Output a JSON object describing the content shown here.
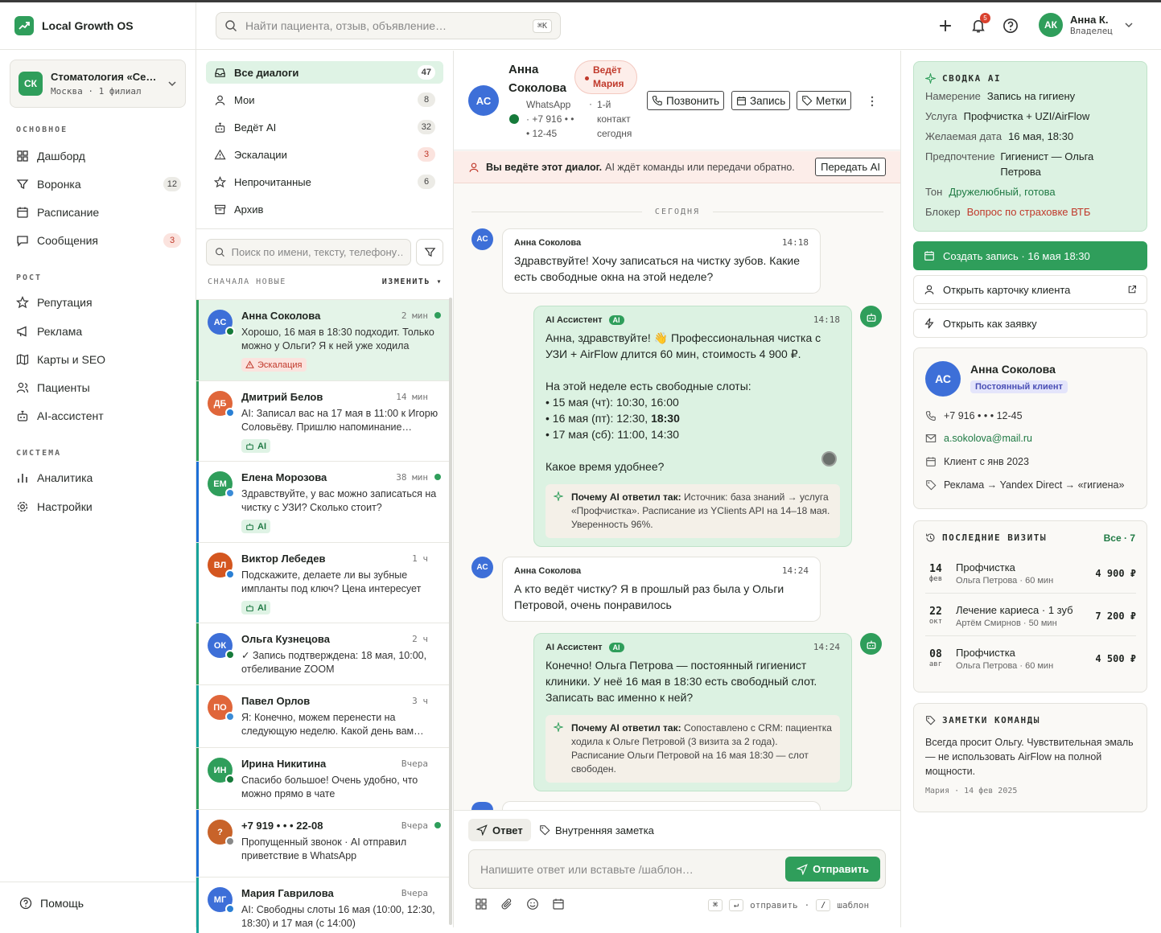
{
  "app": {
    "title": "Local Growth OS"
  },
  "org": {
    "initials": "СК",
    "name": "Стоматология «Се…",
    "sub": "Москва · 1 филиал"
  },
  "nav": {
    "sections": [
      {
        "title": "ОСНОВНОЕ",
        "items": [
          {
            "label": "Дашборд",
            "icon": "dashboard-icon"
          },
          {
            "label": "Воронка",
            "icon": "filter-icon",
            "badge": "12"
          },
          {
            "label": "Расписание",
            "icon": "calendar-icon"
          },
          {
            "label": "Сообщения",
            "icon": "message-icon",
            "badge": "3"
          }
        ]
      },
      {
        "title": "РОСТ",
        "items": [
          {
            "label": "Репутация",
            "icon": "star-icon"
          },
          {
            "label": "Реклама",
            "icon": "megaphone-icon"
          },
          {
            "label": "Карты и SEO",
            "icon": "map-icon"
          },
          {
            "label": "Пациенты",
            "icon": "users-icon"
          },
          {
            "label": "AI-ассистент",
            "icon": "bot-icon"
          }
        ]
      },
      {
        "title": "СИСТЕМА",
        "items": [
          {
            "label": "Аналитика",
            "icon": "chart-icon"
          },
          {
            "label": "Настройки",
            "icon": "gear-icon"
          }
        ]
      }
    ],
    "help": "Помощь"
  },
  "header": {
    "search_placeholder": "Найти пациента, отзыв, объявление…",
    "search_kbd": "⌘K",
    "notifications": "5",
    "user": {
      "initials": "АК",
      "name": "Анна К.",
      "role": "Владелец"
    }
  },
  "filters": [
    {
      "label": "Все диалоги",
      "count": "47",
      "icon": "inbox-icon"
    },
    {
      "label": "Мои",
      "count": "8",
      "icon": "user-icon"
    },
    {
      "label": "Ведёт AI",
      "count": "32",
      "icon": "bot-icon"
    },
    {
      "label": "Эскалации",
      "count": "3",
      "icon": "warning-icon"
    },
    {
      "label": "Непрочитанные",
      "count": "6",
      "icon": "star-icon"
    },
    {
      "label": "Архив",
      "count": "",
      "icon": "archive-icon"
    }
  ],
  "list": {
    "search_placeholder": "Поиск по имени, тексту, телефону…",
    "sort_label": "СНАЧАЛА НОВЫЕ",
    "sort_change": "ИЗМЕНИТЬ ▾",
    "conversations": [
      {
        "initials": "АС",
        "name": "Анна Соколова",
        "time": "2 мин",
        "preview": "Хорошо, 16 мая в 18:30 подходит. Только можно у Ольги? Я к ней уже ходила",
        "tag": "Эскалация",
        "tag_type": "esc",
        "unread": true,
        "avatar_color": "#3d6fd8",
        "channel": "whatsapp",
        "bar_color": "#2f9e5b"
      },
      {
        "initials": "ДБ",
        "name": "Дмитрий Белов",
        "time": "14 мин",
        "preview": "AI: Записал вас на 17 мая в 11:00 к Игорю Соловьёву. Пришлю напоминание накануне",
        "tag": "AI",
        "tag_type": "ai",
        "unread": false,
        "avatar_color": "#e0663a",
        "channel": "telegram",
        "bar_color": "#2f9e5b"
      },
      {
        "initials": "ЕМ",
        "name": "Елена Морозова",
        "time": "38 мин",
        "preview": "Здравствуйте, у вас можно записаться на чистку с УЗИ? Сколько стоит?",
        "tag": "AI",
        "tag_type": "ai",
        "unread": true,
        "avatar_color": "#2f9e5b",
        "channel": "web",
        "bar_color": "#1d6fd6"
      },
      {
        "initials": "ВЛ",
        "name": "Виктор Лебедев",
        "time": "1 ч",
        "preview": "Подскажите, делаете ли вы зубные импланты под ключ? Цена интересует",
        "tag": "AI",
        "tag_type": "ai",
        "unread": false,
        "avatar_color": "#d4561f",
        "channel": "telegram",
        "bar_color": "#17a39a"
      },
      {
        "initials": "ОК",
        "name": "Ольга Кузнецова",
        "time": "2 ч",
        "preview": "✓ Запись подтверждена: 18 мая, 10:00, отбеливание ZOOM",
        "tag": "",
        "tag_type": "",
        "unread": false,
        "avatar_color": "#3d6fd8",
        "channel": "whatsapp",
        "bar_color": "#2f9e5b"
      },
      {
        "initials": "ПО",
        "name": "Павел Орлов",
        "time": "3 ч",
        "preview": "Я: Конечно, можем перенести на следующую неделю. Какой день вам удобен?",
        "tag": "",
        "tag_type": "",
        "unread": false,
        "avatar_color": "#e0663a",
        "channel": "web",
        "bar_color": "#17a39a"
      },
      {
        "initials": "ИН",
        "name": "Ирина Никитина",
        "time": "Вчера",
        "preview": "Спасибо большое! Очень удобно, что можно прямо в чате",
        "tag": "",
        "tag_type": "",
        "unread": false,
        "avatar_color": "#2f9e5b",
        "channel": "whatsapp",
        "bar_color": "#2f9e5b"
      },
      {
        "initials": "?",
        "name": "+7 919 • • • 22-08",
        "time": "Вчера",
        "preview": "Пропущенный звонок · AI отправил приветствие в WhatsApp",
        "tag": "",
        "tag_type": "",
        "unread": true,
        "avatar_color": "#c8632a",
        "channel": "phone",
        "bar_color": "#1d6fd6"
      },
      {
        "initials": "МГ",
        "name": "Мария Гаврилова",
        "time": "Вчера",
        "preview": "AI: Свободны слоты 16 мая (10:00, 12:30, 18:30) и 17 мая (с 14:00)",
        "tag": "",
        "tag_type": "",
        "unread": false,
        "avatar_color": "#3d6fd8",
        "channel": "telegram",
        "bar_color": "#17a39a"
      }
    ]
  },
  "chat": {
    "contact": {
      "initials": "АС",
      "name": "Анна Соколова",
      "channel": "WhatsApp · +7 916 • • • 12-45",
      "visit": "1-й контакт сегодня"
    },
    "lead_chip": "Ведёт Мария",
    "buttons": {
      "call": "Позвонить",
      "book": "Запись",
      "tags": "Метки"
    },
    "banner": {
      "bold": "Вы ведёте этот диалог.",
      "text": "AI ждёт команды или передачи обратно.",
      "button": "Передать AI"
    },
    "day_label": "СЕГОДНЯ",
    "messages": [
      {
        "from": "Анна Соколова",
        "time": "14:18",
        "text": "Здравствуйте! Хочу записаться на чистку зубов. Какие есть свободные окна на этой неделе?"
      },
      {
        "from": "AI Ассистент",
        "badge": "AI",
        "time": "14:18",
        "intro": "Анна, здравствуйте! 👋 Профессиональная чистка с УЗИ + AirFlow длится 60 мин, стоимость 4 900 ₽.",
        "slots_intro": "На этой неделе есть свободные слоты:",
        "slots": [
          "15 мая (чт): 10:30, 16:00",
          "16 мая (пт): 12:30, ",
          "18:30",
          "17 мая (сб): 11:00, 14:30"
        ],
        "outro": "Какое время удобнее?",
        "why_label": "Почему AI ответил так:",
        "why_text": "Источник: база знаний → услуга «Профчистка». Расписание из YClients API на 14–18 мая. Уверенность 96%."
      },
      {
        "from": "Анна Соколова",
        "time": "14:24",
        "text": "А кто ведёт чистку? Я в прошлый раз была у Ольги Петровой, очень понравилось"
      },
      {
        "from": "AI Ассистент",
        "badge": "AI",
        "time": "14:24",
        "text": "Конечно! Ольга Петрова — постоянный гигиенист клиники. У неё 16 мая в 18:30 есть свободный слот. Записать вас именно к ней?",
        "why_label": "Почему AI ответил так:",
        "why_text": "Сопоставлено с CRM: пациентка ходила к Ольге Петровой (3 визита за 2 года). Расписание Ольги Петровой на 16 мая 18:30 — слот свободен."
      }
    ],
    "composer": {
      "tab_reply": "Ответ",
      "tab_note": "Внутренняя заметка",
      "placeholder": "Напишите ответ или вставьте /шаблон…",
      "send": "Отправить",
      "hint_cmd": "⌘",
      "hint_enter": "↵",
      "hint_send": "отправить",
      "hint_sep": "·",
      "hint_slash": "/",
      "hint_template": "шаблон"
    }
  },
  "summary": {
    "title": "СВОДКА AI",
    "rows": [
      {
        "k": "Намерение",
        "v": "Запись на гигиену",
        "style": ""
      },
      {
        "k": "Услуга",
        "v": "Профчистка + UZI/AirFlow",
        "style": ""
      },
      {
        "k": "Желаемая дата",
        "v": "16 мая, 18:30",
        "style": ""
      },
      {
        "k": "Предпочтение",
        "v": "Гигиенист — Ольга Петрова",
        "style": ""
      },
      {
        "k": "Тон",
        "v": "Дружелюбный, готова",
        "style": "green"
      },
      {
        "k": "Блокер",
        "v": "Вопрос по страховке ВТБ",
        "style": "red"
      }
    ]
  },
  "actions": {
    "create": "Создать запись · 16 мая 18:30",
    "open_card": "Открыть карточку клиента",
    "open_lead": "Открыть как заявку"
  },
  "client": {
    "initials": "АС",
    "name": "Анна Соколова",
    "tag": "Постоянный клиент",
    "phone": "+7 916 • • • 12-45",
    "email": "a.sokolova@mail.ru",
    "since": "Клиент с янв 2023",
    "source": "Реклама → Yandex Direct → «гигиена»"
  },
  "visits": {
    "title": "ПОСЛЕДНИЕ ВИЗИТЫ",
    "all": "Все · 7",
    "items": [
      {
        "day": "14",
        "month": "фев",
        "service": "Профчистка",
        "doctor": "Ольга Петрова · 60 мин",
        "price": "4 900 ₽"
      },
      {
        "day": "22",
        "month": "окт",
        "service": "Лечение кариеса · 1 зуб",
        "doctor": "Артём Смирнов · 50 мин",
        "price": "7 200 ₽"
      },
      {
        "day": "08",
        "month": "авг",
        "service": "Профчистка",
        "doctor": "Ольга Петрова · 60 мин",
        "price": "4 500 ₽"
      }
    ]
  },
  "notes": {
    "title": "ЗАМЕТКИ КОМАНДЫ",
    "text": "Всегда просит Ольгу. Чувствительная эмаль — не использовать AirFlow на полной мощности.",
    "meta": "Мария · 14 фев 2025"
  },
  "colors": {
    "accent": "#2f9e5b",
    "accent_light": "#dcf2e2",
    "danger": "#c0392b",
    "blue": "#3d6fd8"
  }
}
